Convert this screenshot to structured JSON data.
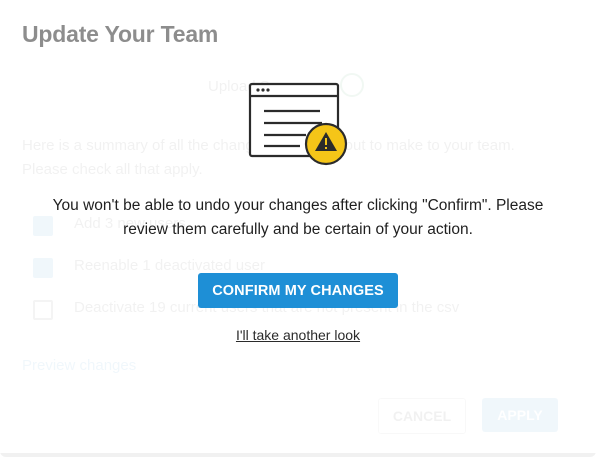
{
  "dialog": {
    "title": "Update Your Team"
  },
  "background": {
    "step_label": "Upload Summary",
    "summary_text": "Here is a summary of all the changes you are about to make to your team. Please check all that apply.",
    "options": [
      {
        "label": "Add 3 new users",
        "checked": true
      },
      {
        "label": "Reenable 1 deactivated user",
        "checked": true
      },
      {
        "label": "Deactivate 19 current users that are not present in the csv",
        "checked": false
      }
    ],
    "preview_link": "Preview changes",
    "cancel_label": "CANCEL",
    "apply_label": "APPLY"
  },
  "confirmation": {
    "illustration": "document-warning-icon",
    "message": "You won't be able to undo your changes after clicking \"Confirm\". Please review them carefully and be certain of your action.",
    "confirm_label": "CONFIRM MY CHANGES",
    "secondary_link": "I'll take another look"
  },
  "colors": {
    "primary": "#1e8fd6",
    "warning": "#f5c518",
    "text": "#1f1f1f"
  }
}
